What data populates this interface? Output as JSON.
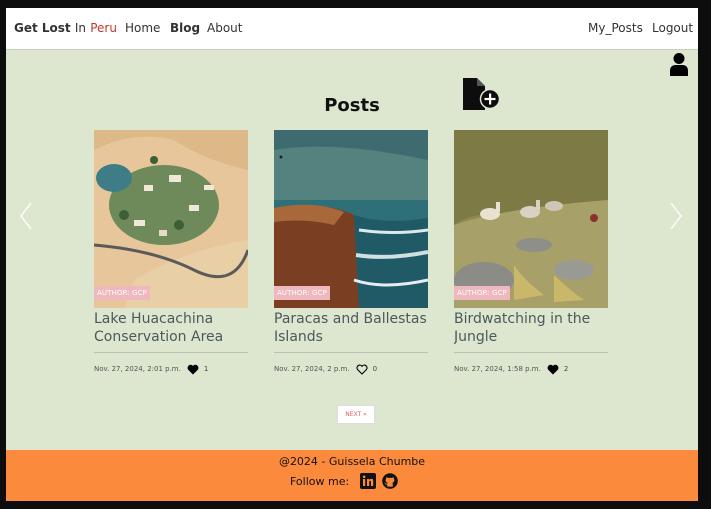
{
  "navbar": {
    "brand_main": "Get Lost",
    "brand_in": "In",
    "brand_peru": "Peru",
    "home": "Home",
    "blog": "Blog",
    "about": "About",
    "my_posts": "My_Posts",
    "logout": "Logout"
  },
  "main": {
    "title": "Posts",
    "next_label": "NEXT »"
  },
  "posts": [
    {
      "title": "Lake Huacachina Conservation Area",
      "author": "AUTHOR: GCP",
      "date": "Nov. 27, 2024, 2:01 p.m.",
      "likes": "1",
      "liked": true,
      "image": "desert-oasis-image"
    },
    {
      "title": "Paracas and Ballestas Islands",
      "author": "AUTHOR: GCP",
      "date": "Nov. 27, 2024, 2 p.m.",
      "likes": "0",
      "liked": false,
      "image": "coastal-cliff-image"
    },
    {
      "title": "Birdwatching in the Jungle",
      "author": "AUTHOR: GCP",
      "date": "Nov. 27, 2024, 1:58 p.m.",
      "likes": "2",
      "liked": true,
      "image": "alpaca-hillside-image"
    }
  ],
  "footer": {
    "credit": "@2024 - Guissela Chumbe",
    "follow": "Follow me:"
  },
  "icons": [
    "user-icon",
    "add-post-icon",
    "heart-icon",
    "linkedin-icon",
    "github-icon",
    "chevron-left-icon",
    "chevron-right-icon"
  ],
  "colors": {
    "page_background": "#dde6cf",
    "footer_background": "#fc8a3d",
    "brand_accent": "#c0392b",
    "badge": "#efb8bf",
    "title_text": "#4a5a5c"
  }
}
